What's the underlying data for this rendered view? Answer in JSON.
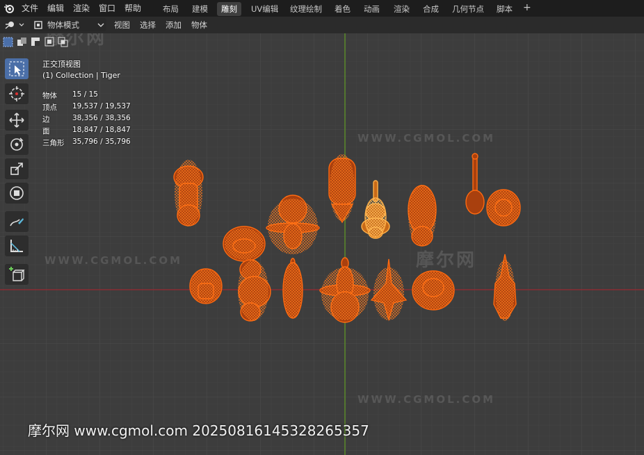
{
  "menu": {
    "file": "文件",
    "edit": "编辑",
    "render": "渲染",
    "window": "窗口",
    "help": "帮助"
  },
  "workspace_tabs": [
    "布局",
    "建模",
    "雕刻",
    "UV编辑",
    "纹理绘制",
    "着色",
    "动画",
    "渲染",
    "合成",
    "几何节点",
    "脚本"
  ],
  "active_tab": "雕刻",
  "add_tab_symbol": "+",
  "header": {
    "mode": "物体模式",
    "view": "视图",
    "select": "选择",
    "add": "添加",
    "object": "物体"
  },
  "overlay": {
    "view_name": "正交顶视图",
    "collection": "(1) Collection | Tiger",
    "stats": [
      {
        "label": "物体",
        "value": "15 / 15"
      },
      {
        "label": "顶点",
        "value": "19,537 / 19,537"
      },
      {
        "label": "边",
        "value": "38,356 / 38,356"
      },
      {
        "label": "面",
        "value": "18,847 / 18,847"
      },
      {
        "label": "三角形",
        "value": "35,796 / 35,796"
      }
    ]
  },
  "watermarks": {
    "brand": "摩尔网",
    "site": "WWW.CGMOL.COM"
  },
  "footer_watermark": "摩尔网 www.cgmol.com 20250816145328265357",
  "colors": {
    "mesh_wire": "#ff6a10",
    "mesh_fill": "#9a3a0c",
    "mesh_selected": "#ffab40",
    "axis_x": "#8a2c33",
    "axis_y": "#5a8a2a",
    "grid": "#474747"
  }
}
